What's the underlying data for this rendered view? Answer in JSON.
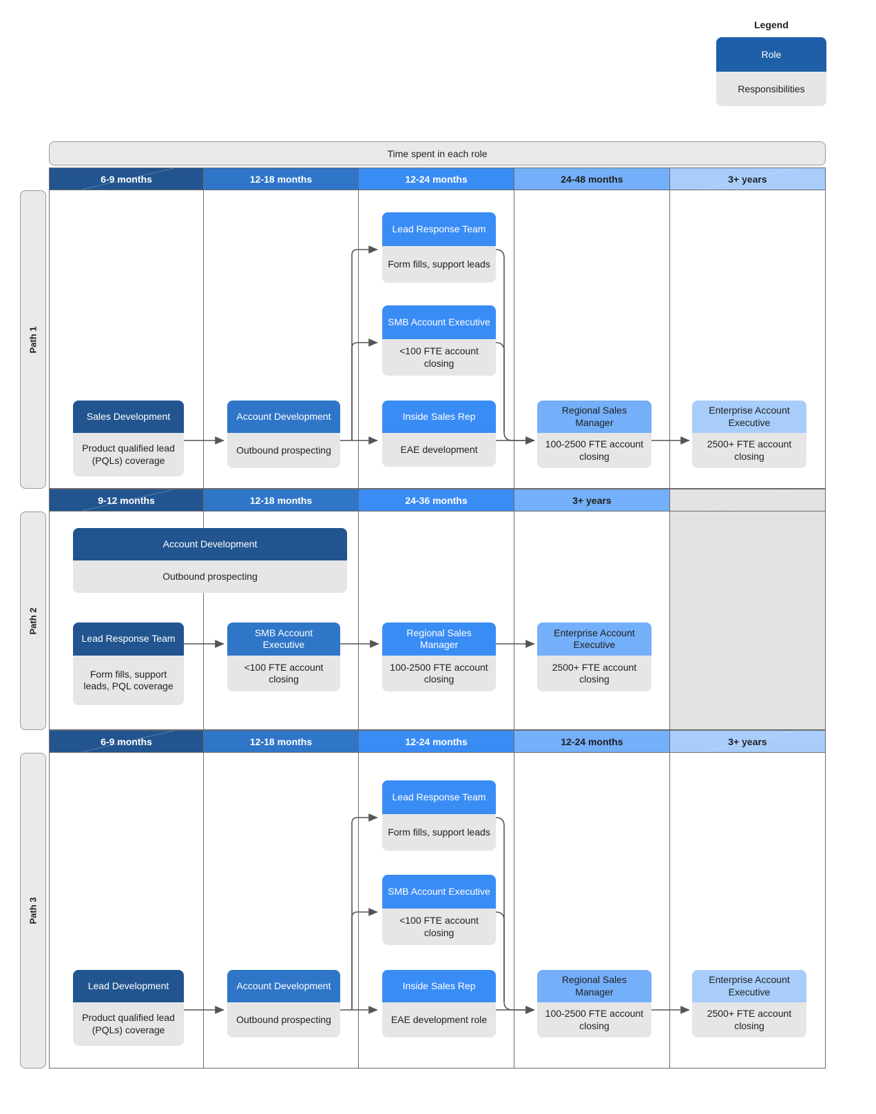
{
  "legend": {
    "title": "Legend",
    "role_label": "Role",
    "responsibilities_label": "Responsibilities"
  },
  "banner": {
    "title": "Time spent in each role"
  },
  "paths": [
    {
      "label": "Path 1",
      "headers": [
        "6-9 months",
        "12-18 months",
        "12-24 months",
        "24-48 months",
        "3+ years"
      ],
      "nodes": [
        {
          "role": "Sales Development",
          "resp": "Product qualified lead (PQLs) coverage"
        },
        {
          "role": "Account Development",
          "resp": "Outbound prospecting"
        },
        {
          "role": "Lead Response Team",
          "resp": "Form fills, support leads"
        },
        {
          "role": "SMB Account Executive",
          "resp": "<100 FTE account closing"
        },
        {
          "role": "Inside Sales Rep",
          "resp": "EAE development"
        },
        {
          "role": "Regional Sales Manager",
          "resp": "100-2500 FTE account closing"
        },
        {
          "role": "Enterprise Account Executive",
          "resp": "2500+ FTE account closing"
        }
      ]
    },
    {
      "label": "Path 2",
      "headers": [
        "9-12 months",
        "12-18 months",
        "24-36 months",
        "3+ years",
        ""
      ],
      "nodes": [
        {
          "role": "Account Development",
          "resp": "Outbound prospecting"
        },
        {
          "role": "Lead Response Team",
          "resp": "Form fills, support leads, PQL coverage"
        },
        {
          "role": "SMB Account Executive",
          "resp": "<100 FTE account closing"
        },
        {
          "role": "Regional Sales Manager",
          "resp": "100-2500 FTE account closing"
        },
        {
          "role": "Enterprise Account Executive",
          "resp": "2500+ FTE account closing"
        }
      ]
    },
    {
      "label": "Path 3",
      "headers": [
        "6-9 months",
        "12-18 months",
        "12-24 months",
        "12-24 months",
        "3+ years"
      ],
      "nodes": [
        {
          "role": "Lead Development",
          "resp": "Product qualified lead (PQLs) coverage"
        },
        {
          "role": "Account Development",
          "resp": "Outbound prospecting"
        },
        {
          "role": "Lead Response Team",
          "resp": "Form fills, support leads"
        },
        {
          "role": "SMB Account Executive",
          "resp": "<100 FTE account closing"
        },
        {
          "role": "Inside Sales Rep",
          "resp": "EAE development role"
        },
        {
          "role": "Regional Sales Manager",
          "resp": "100-2500 FTE account closing"
        },
        {
          "role": "Enterprise Account Executive",
          "resp": "2500+ FTE account closing"
        }
      ]
    }
  ],
  "colors": {
    "stage_1": "#22558f",
    "stage_2": "#2f76c8",
    "stage_3": "#3a8cf5",
    "stage_4": "#74aff9",
    "stage_5": "#a8cdfb",
    "responsibility_bg": "#e6e6e6",
    "panel_bg": "#e9e9e9",
    "disabled_bg": "#e3e3e3",
    "border": "#6b6b6b",
    "connector": "#555555"
  }
}
